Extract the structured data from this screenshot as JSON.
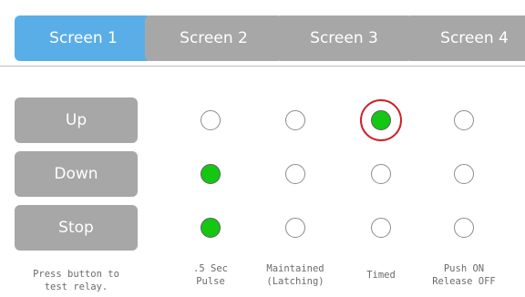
{
  "tabs": [
    {
      "label": "Screen 1",
      "active": true
    },
    {
      "label": "Screen 2",
      "active": false
    },
    {
      "label": "Screen 3",
      "active": false
    },
    {
      "label": "Screen 4",
      "active": false
    }
  ],
  "rows": [
    {
      "label": "Up"
    },
    {
      "label": "Down"
    },
    {
      "label": "Stop"
    }
  ],
  "modes": [
    {
      "label": ".5 Sec\nPulse"
    },
    {
      "label": "Maintained\n(Latching)"
    },
    {
      "label": "Timed"
    },
    {
      "label": "Push ON\nRelease OFF"
    }
  ],
  "selection": {
    "Up": "Timed",
    "Down": ".5 Sec Pulse",
    "Stop": ".5 Sec Pulse"
  },
  "highlighted": {
    "row": "Up",
    "mode": "Timed"
  },
  "hint": "Press button to\ntest relay.",
  "colors": {
    "tab_active": "#5aaee8",
    "tab_inactive": "#a7a7a7",
    "radio_selected": "#13c713",
    "highlight_ring": "#d0202a"
  }
}
